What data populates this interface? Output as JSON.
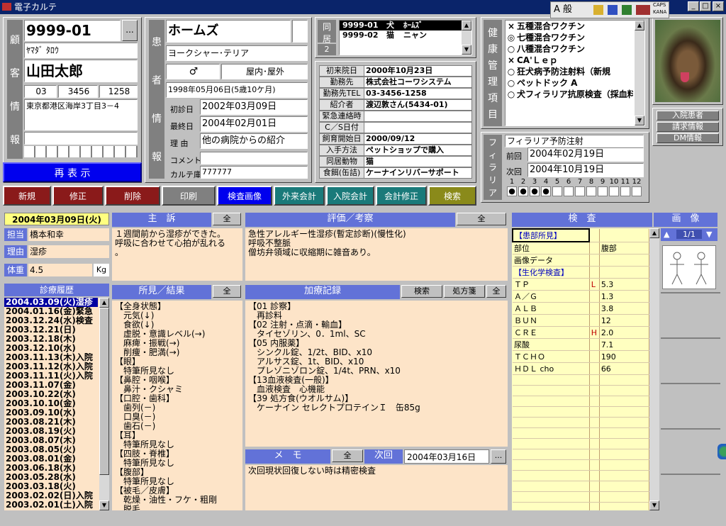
{
  "window": {
    "title": "電子カルテ",
    "minimize": "_",
    "maximize": "□",
    "close": "×"
  },
  "ime": {
    "text": "A 般",
    "caps": "CAPS",
    "kana": "KANA"
  },
  "client": {
    "section_label": "顧客情報",
    "label_chars": [
      "顧",
      "客",
      "情",
      "報"
    ],
    "id": "9999-01",
    "id_button": "...",
    "kana": "ﾔﾏﾀﾞ ﾀﾛｳ",
    "name": "山田太郎",
    "phone": [
      "03",
      "3456",
      "1258"
    ],
    "address": "東京都港区海岸3丁目3－4",
    "refresh_button": "再 表 示"
  },
  "patient": {
    "label_chars": [
      "患",
      "者",
      "情",
      "報"
    ],
    "name": "ホームズ",
    "breed": "ヨークシャー･テリア",
    "sex": "♂",
    "living": "屋内･屋外",
    "birthday": "1998年05月06日(5歳10ケ月)",
    "first_visit_label": "初診日",
    "first_visit": "2002年03月09日",
    "last_visit_label": "最終日",
    "last_visit": "2004年02月01日",
    "reason_label": "理 由",
    "reason": "他の病院からの紹介",
    "comment_label": "コメント",
    "comment": "",
    "chart_label": "カルテ庫",
    "chart_no": "777777"
  },
  "household": {
    "label_chars": [
      "同",
      "居"
    ],
    "count": "2",
    "rows": [
      {
        "id": "9999-01",
        "species": "犬",
        "name": "ﾎｰﾑｽﾞ"
      },
      {
        "id": "9999-02",
        "species": "猫",
        "name": "ニャン"
      }
    ]
  },
  "info": [
    {
      "label": "初来院日",
      "value": "2000年10月23日"
    },
    {
      "label": "勤務先",
      "value": "株式会社コーワシステム"
    },
    {
      "label": "勤務先TEL",
      "value": "03-3456-1258"
    },
    {
      "label": "紹介者",
      "value": "渡辺敦さん(5434-01)"
    },
    {
      "label": "緊急連絡時",
      "value": ""
    },
    {
      "label": "C／S日付",
      "value": ""
    },
    {
      "label": "飼育開始日",
      "value": "2000/09/12"
    },
    {
      "label": "入手方法",
      "value": "ペットショップで購入"
    },
    {
      "label": "同居動物",
      "value": "猫"
    },
    {
      "label": "食餌(缶詰)",
      "value": "ケーナインリバーサポート"
    }
  ],
  "health": {
    "label_chars": [
      "健",
      "康",
      "管",
      "理",
      "項",
      "目"
    ],
    "items": [
      {
        "mark": "×",
        "text": "五種混合ワクチン"
      },
      {
        "mark": "◎",
        "text": "七種混合ワクチン"
      },
      {
        "mark": "○",
        "text": "八種混合ワクチン"
      },
      {
        "mark": "×",
        "text": "CA'Ｌｅｐ"
      },
      {
        "mark": "○",
        "text": "狂犬病予防注射料（新規"
      },
      {
        "mark": "○",
        "text": "ペットドック A"
      },
      {
        "mark": "○",
        "text": "犬フィラリア抗原検査（採血料"
      }
    ]
  },
  "side_buttons": {
    "inpatient": "入院患者",
    "billing": "請求情報",
    "dm": "DM情報"
  },
  "filaria": {
    "label_chars": [
      "フ",
      "ィ",
      "ラ",
      "リ",
      "ア"
    ],
    "title": "フィラリア予防注射",
    "prev_label": "前回",
    "prev": "2004年02月19日",
    "next_label": "次回",
    "next": "2004年10月19日",
    "months": [
      "1",
      "2",
      "3",
      "4",
      "5",
      "6",
      "7",
      "8",
      "9",
      "10",
      "11",
      "12"
    ],
    "filled": [
      true,
      true,
      true,
      true,
      false,
      false,
      false,
      false,
      false,
      false,
      false,
      false
    ]
  },
  "toolbar": {
    "new": "新規",
    "edit": "修正",
    "delete": "削除",
    "print": "印刷",
    "exam_image": "検査画像",
    "outpatient_bill": "外来会計",
    "inpatient_bill": "入院会計",
    "bill_edit": "会計修正",
    "search": "検索"
  },
  "visit": {
    "date": "2004年03月09日(火)",
    "doctor_label": "担当",
    "doctor": "橋本和幸",
    "reason_label": "理由",
    "reason": "湿疹",
    "weight_label": "体重",
    "weight": "4.5",
    "weight_unit": "Kg"
  },
  "history": {
    "title": "診療履歴",
    "items": [
      "2004.03.09(火)湿疹",
      "2004.01.16(金)緊急",
      "2003.12.24(水)検査",
      "2003.12.21(日)",
      "2003.12.18(木)",
      "2003.12.10(水)",
      "2003.11.13(木)入院",
      "2003.11.12(水)入院",
      "2003.11.11(火)入院",
      "2003.11.07(金)",
      "2003.10.22(水)",
      "2003.10.10(金)",
      "2003.09.10(水)",
      "2003.08.21(木)",
      "2003.08.19(火)",
      "2003.08.07(木)",
      "2003.08.05(火)",
      "2003.08.01(金)",
      "2003.06.18(水)",
      "2003.05.28(水)",
      "2003.03.18(火)",
      "2003.02.02(日)入院",
      "2003.02.01(土)入院"
    ]
  },
  "complaint": {
    "title": "主　訴",
    "all": "全",
    "text": "１週間前から湿疹ができた。\n呼吸に合わせて心拍が乱れる\n。"
  },
  "assessment": {
    "title": "評価／考察",
    "all": "全",
    "text": "急性アレルギー性湿疹(暫定診断)(慢性化)\n呼吸不整脈\n僧坊弁領域に収縮期に雑音あり。"
  },
  "findings": {
    "title": "所見／結果",
    "all": "全",
    "text": "【全身状態】\n　元気(↓)\n　食欲(↓)\n　虚脱・意識レベル(→)\n　麻痺・振戦(→)\n　削痩・肥満(→)\n【眼】\n　特筆所見なし\n【鼻腔・咽喉】\n　鼻汁・クシャミ\n【口腔・歯科】\n　歯列(－)\n　口臭(－)\n　歯石(－)\n【耳】\n　特筆所見なし\n【四肢・脊椎】\n　特筆所見なし\n【腹部】\n　特筆所見なし\n【被毛／皮膚】\n　乾燥・油性・フケ・粗剛\n　脱毛"
  },
  "treatment": {
    "title": "加療記録",
    "search": "検索",
    "prescription": "処方箋",
    "all": "全",
    "text": "【01 診察】\n　再診料\n【02 注射・点滴・輸血】\n　タイセゾリン、0．1ml、SC\n【05 内服薬】\n　シンクル錠、1/2t、BID、x10\n　アルサス錠、1t、BID、x10\n　プレゾニゾロン錠、1/4t、PRN、x10\n【13血液検査(一般)】\n　血液検査　心機能\n【39 処方食(ウオルサム)】\n　ケーナイン セレクトプロテインＩ　缶85g"
  },
  "memo": {
    "title": "メ　モ",
    "all": "全",
    "next_label": "次回",
    "next_date": "2004年03月16日",
    "button": "...",
    "text": "次回現状回復しない時は精密検査"
  },
  "exam": {
    "title": "検　査",
    "rows": [
      {
        "name": "【患部所見】",
        "flag": "",
        "value": ""
      },
      {
        "name": "部位",
        "flag": "",
        "value": "腹部"
      },
      {
        "name": "画像データ",
        "flag": "",
        "value": ""
      },
      {
        "name": "【生化学検査】",
        "flag": "",
        "value": ""
      },
      {
        "name": "ＴＰ",
        "flag": "L",
        "value": "5.3"
      },
      {
        "name": "Ａ／Ｇ",
        "flag": "",
        "value": "1.3"
      },
      {
        "name": "ＡＬＢ",
        "flag": "",
        "value": "3.8"
      },
      {
        "name": "ＢＵＮ",
        "flag": "",
        "value": "12"
      },
      {
        "name": "ＣＲＥ",
        "flag": "H",
        "value": "2.0"
      },
      {
        "name": "尿酸",
        "flag": "",
        "value": "7.1"
      },
      {
        "name": "ＴＣＨＯ",
        "flag": "",
        "value": "190"
      },
      {
        "name": "ＨＤＬ cho",
        "flag": "",
        "value": "66"
      },
      {
        "name": "",
        "flag": "",
        "value": ""
      },
      {
        "name": "",
        "flag": "",
        "value": ""
      },
      {
        "name": "",
        "flag": "",
        "value": ""
      },
      {
        "name": "",
        "flag": "",
        "value": ""
      },
      {
        "name": "",
        "flag": "",
        "value": ""
      },
      {
        "name": "",
        "flag": "",
        "value": ""
      },
      {
        "name": "",
        "flag": "",
        "value": ""
      },
      {
        "name": "",
        "flag": "",
        "value": ""
      },
      {
        "name": "",
        "flag": "",
        "value": ""
      },
      {
        "name": "",
        "flag": "",
        "value": ""
      },
      {
        "name": "",
        "flag": "",
        "value": ""
      },
      {
        "name": "",
        "flag": "",
        "value": ""
      },
      {
        "name": "",
        "flag": "",
        "value": ""
      },
      {
        "name": "",
        "flag": "",
        "value": ""
      }
    ]
  },
  "image": {
    "title": "画　像",
    "page": "1/1"
  }
}
